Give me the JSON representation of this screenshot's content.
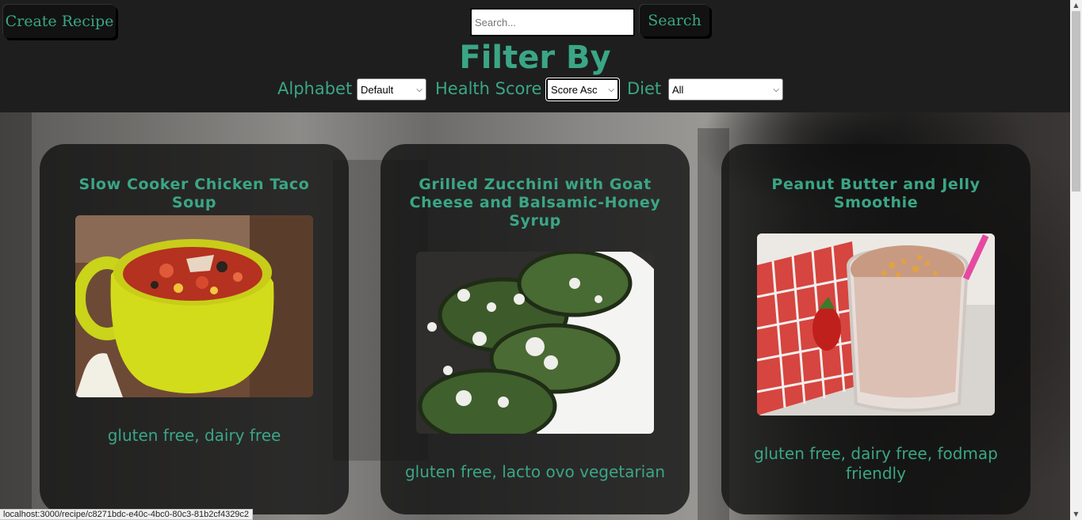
{
  "header": {
    "create_label": "Create Recipe",
    "search_placeholder": "Search...",
    "search_value": "",
    "search_label": "Search"
  },
  "filters": {
    "title": "Filter By",
    "alphabet_label": "Alphabet",
    "alphabet_value": "Default",
    "health_label": "Health Score",
    "health_value": "Score Asc",
    "diet_label": "Diet",
    "diet_value": "All"
  },
  "recipes": [
    {
      "title": "Slow Cooker Chicken Taco Soup",
      "diets": "gluten free, dairy free"
    },
    {
      "title": "Grilled Zucchini with Goat Cheese and Balsamic-Honey Syrup",
      "diets": "gluten free, lacto ovo vegetarian"
    },
    {
      "title": "Peanut Butter and Jelly Smoothie",
      "diets": "gluten free, dairy free, fodmap friendly"
    }
  ],
  "status_url": "localhost:3000/recipe/c8271bdc-e40c-4bc0-80c3-81b2cf4329c2",
  "colors": {
    "accent": "#3aa685",
    "background": "#1e1e1e",
    "card": "#101010"
  },
  "icons": {
    "select_arrow": "chevron-down-icon",
    "scroll_up": "arrow-up-icon",
    "scroll_down": "arrow-down-icon"
  }
}
